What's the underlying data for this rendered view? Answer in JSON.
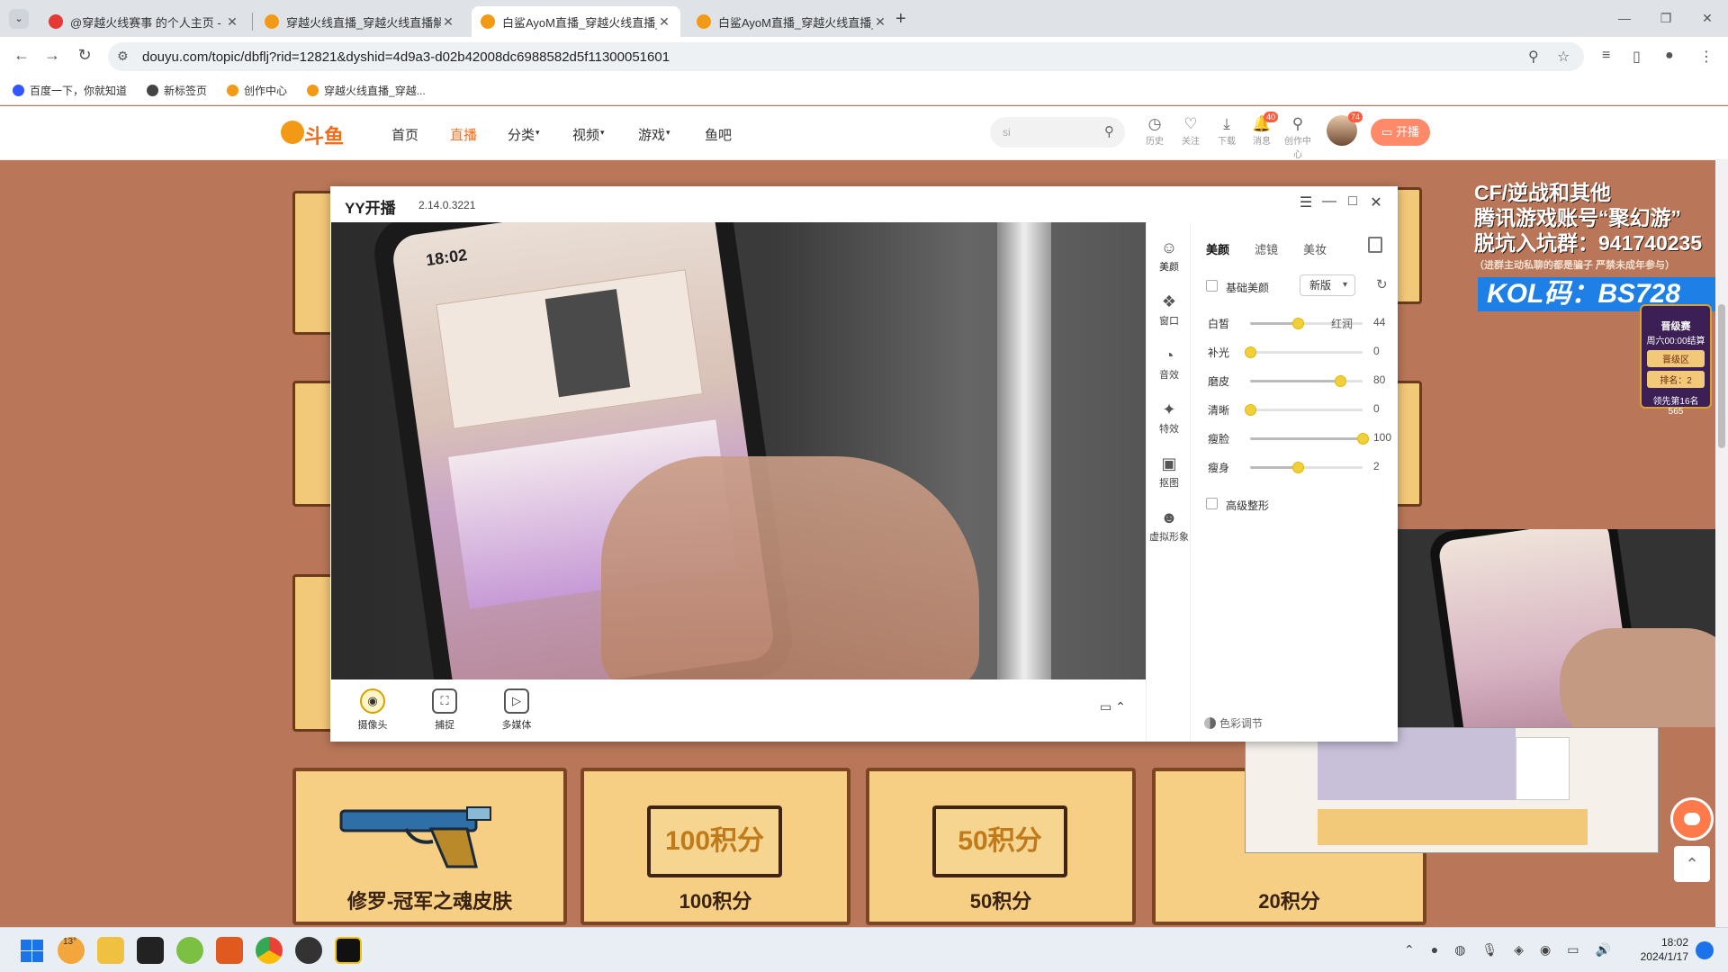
{
  "browser": {
    "tabs": [
      {
        "title": "@穿越火线赛事 的个人主页 - 抖",
        "favicon_color": "#e53935",
        "active": false
      },
      {
        "title": "穿越火线直播_穿越火线直播解",
        "favicon_color": "#f29a16",
        "active": false
      },
      {
        "title": "白鲨AyoM直播_穿越火线直播_",
        "favicon_color": "#f29a16",
        "active": true
      },
      {
        "title": "白鲨AyoM直播_穿越火线直播_",
        "favicon_color": "#f29a16",
        "active": false
      }
    ],
    "new_tab": "+",
    "url": "douyu.com/topic/dbflj?rid=12821&dyshid=4d9a3-d02b42008dc6988582d5f11300051601",
    "bookmarks": [
      {
        "label": "百度一下，你就知道",
        "color": "#3355ff"
      },
      {
        "label": "新标签页",
        "color": "#444"
      },
      {
        "label": "创作中心",
        "color": "#f29a16"
      },
      {
        "label": "穿越火线直播_穿越...",
        "color": "#f29a16"
      }
    ]
  },
  "site": {
    "logo_text": "斗鱼",
    "nav": [
      "首页",
      "直播",
      "分类",
      "视频",
      "游戏",
      "鱼吧"
    ],
    "nav_active": "直播",
    "search_placeholder": "si",
    "header_icons": [
      {
        "name": "history",
        "label": "历史",
        "glyph": "◷"
      },
      {
        "name": "follow",
        "label": "关注",
        "glyph": "♡"
      },
      {
        "name": "download",
        "label": "下载",
        "glyph": "⤓"
      },
      {
        "name": "message",
        "label": "消息",
        "glyph": "🔔",
        "badge": "40"
      },
      {
        "name": "creator",
        "label": "创作中心",
        "glyph": "⚲"
      }
    ],
    "avatar_badge": "74",
    "start_button": "开播"
  },
  "promo": {
    "line1": "CF/逆战和其他",
    "line2": "腾讯游戏账号“聚幻游”",
    "line3": "脱坑入坑群：941740235",
    "line4": "（进群主动私聊的都是骗子 严禁未成年参与）",
    "kol": "KOL码：BS728"
  },
  "rank_card": {
    "title": "晋级赛",
    "sub": "周六00:00结算",
    "btn": "晋级区",
    "rank": "排名：2",
    "lead": "领先第16名",
    "score": "565"
  },
  "prizes": [
    {
      "label": "修罗-冠军之魂皮肤",
      "board": ""
    },
    {
      "label": "100积分",
      "board": "100积分"
    },
    {
      "label": "50积分",
      "board": "50积分"
    },
    {
      "label": "20积分",
      "board": ""
    }
  ],
  "yy": {
    "title": "YY开播",
    "version": "2.14.0.3221",
    "phone_time": "18:02",
    "tools": [
      {
        "label": "摄像头",
        "glyph": "◉"
      },
      {
        "label": "捕捉",
        "glyph": "⛶"
      },
      {
        "label": "多媒体",
        "glyph": "▷"
      }
    ],
    "sidebar": [
      {
        "label": "美颜",
        "glyph": "☺"
      },
      {
        "label": "窗口",
        "glyph": "❖"
      },
      {
        "label": "音效",
        "glyph": "◔"
      },
      {
        "label": "特效",
        "glyph": "✦"
      },
      {
        "label": "抠图",
        "glyph": "▣"
      },
      {
        "label": "虚拟形象",
        "glyph": "☻"
      }
    ],
    "panel_tabs": [
      "美颜",
      "滤镜",
      "美妆"
    ],
    "basic_beauty": "基础美颜",
    "version_select": "新版",
    "sliders": [
      {
        "label": "白皙",
        "value": 44,
        "pos": 0.42,
        "extra": "红润"
      },
      {
        "label": "补光",
        "value": 0,
        "pos": 0,
        "extra": ""
      },
      {
        "label": "磨皮",
        "value": 80,
        "pos": 0.8,
        "extra": ""
      },
      {
        "label": "清晰",
        "value": 0,
        "pos": 0,
        "extra": ""
      },
      {
        "label": "瘦脸",
        "value": 100,
        "pos": 1,
        "extra": ""
      },
      {
        "label": "瘦身",
        "value": 2,
        "pos": 0.42,
        "extra": ""
      }
    ],
    "advanced_shape": "高级整形",
    "color_adjust": "色彩调节"
  },
  "taskbar": {
    "weather": "13°",
    "time": "18:02",
    "date": "2024/1/17"
  }
}
